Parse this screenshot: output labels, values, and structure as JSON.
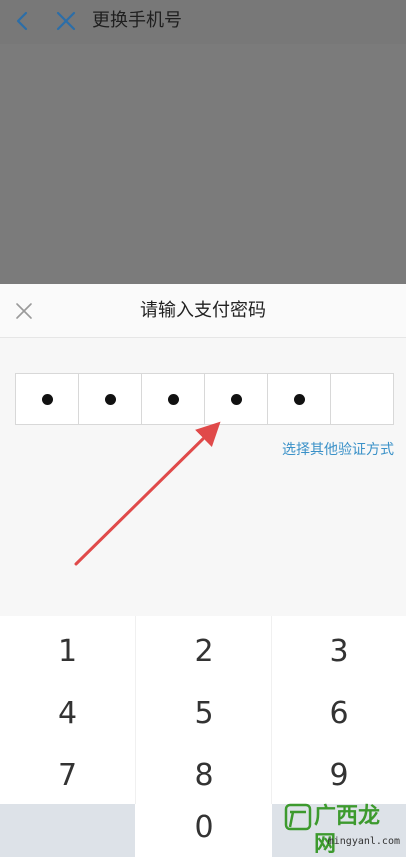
{
  "topbar": {
    "title": "更换手机号",
    "back_icon": "chevron-left-icon",
    "close_icon": "close-icon"
  },
  "dialog": {
    "title": "请输入支付密码",
    "close_icon": "close-icon",
    "pin_total": 6,
    "pin_filled": 5,
    "other_method": "选择其他验证方式",
    "accent_color": "#3a91c8"
  },
  "keypad": {
    "keys": [
      "1",
      "2",
      "3",
      "4",
      "5",
      "6",
      "7",
      "8",
      "9",
      "0"
    ]
  },
  "watermark": {
    "brand": "广西龙网",
    "domain": "mingyanl.com"
  }
}
